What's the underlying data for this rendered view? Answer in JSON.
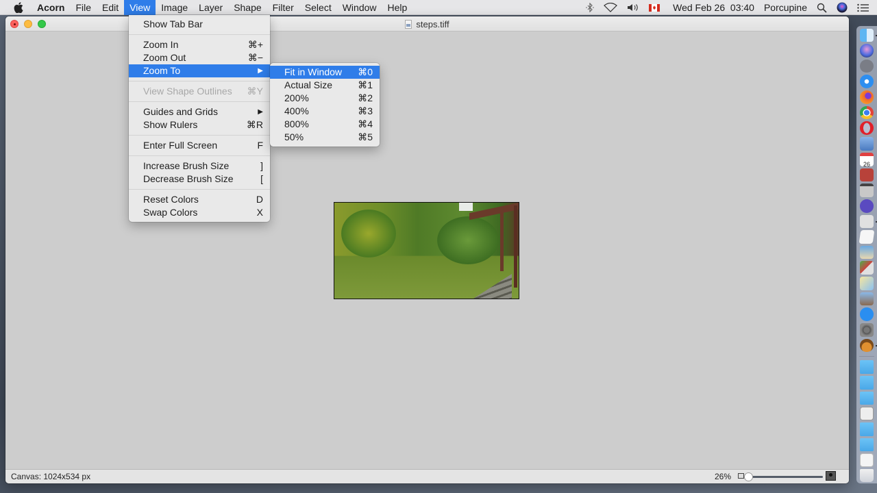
{
  "menubar": {
    "app_name": "Acorn",
    "menus": [
      "File",
      "Edit",
      "View",
      "Image",
      "Layer",
      "Shape",
      "Filter",
      "Select",
      "Window",
      "Help"
    ],
    "active_menu": "View",
    "status": {
      "icons": [
        "bluetooth-icon",
        "wifi-icon",
        "volume-icon",
        "flag-canada-icon"
      ],
      "datetime": "Wed Feb 26  03:40",
      "user": "Porcupine"
    }
  },
  "window": {
    "title": "steps.tiff",
    "status_bar": {
      "canvas_info": "Canvas: 1024x534 px",
      "zoom_percent": "26%",
      "zoom_slider_value": 0.0
    }
  },
  "view_menu": {
    "items": [
      {
        "label": "Show Tab Bar",
        "shortcut": ""
      },
      {
        "label": "Zoom In",
        "shortcut": "⌘+"
      },
      {
        "label": "Zoom Out",
        "shortcut": "⌘−"
      },
      {
        "label": "Zoom To",
        "shortcut": "▶"
      },
      {
        "label": "View Shape Outlines",
        "shortcut": "⌘Y"
      },
      {
        "label": "Guides and Grids",
        "shortcut": "▶"
      },
      {
        "label": "Show Rulers",
        "shortcut": "⌘R"
      },
      {
        "label": "Enter Full Screen",
        "shortcut": "F"
      },
      {
        "label": "Increase Brush Size",
        "shortcut": "]"
      },
      {
        "label": "Decrease Brush Size",
        "shortcut": "["
      },
      {
        "label": "Reset Colors",
        "shortcut": "D"
      },
      {
        "label": "Swap Colors",
        "shortcut": "X"
      }
    ]
  },
  "zoom_to_submenu": {
    "items": [
      {
        "label": "Fit in Window",
        "shortcut": "⌘0"
      },
      {
        "label": "Actual Size",
        "shortcut": "⌘1"
      },
      {
        "label": "200%",
        "shortcut": "⌘2"
      },
      {
        "label": "400%",
        "shortcut": "⌘3"
      },
      {
        "label": "800%",
        "shortcut": "⌘4"
      },
      {
        "label": "50%",
        "shortcut": "⌘5"
      }
    ]
  },
  "dock": {
    "apps": [
      "Finder",
      "Siri",
      "Launchpad",
      "Safari",
      "Firefox",
      "Chrome",
      "Opera",
      "Preview",
      "Calendar",
      "Dictionary",
      "Calculator",
      "BBEdit",
      "Image Capture",
      "TextEdit",
      "Preview Photos",
      "Photo Editor",
      "Maps",
      "Photos",
      "App Store",
      "System Preferences",
      "Acorn"
    ],
    "calendar_day": "26",
    "folders": [
      "Applications",
      "Documents",
      "Downloads",
      "Recent File",
      "Folder",
      "Folder",
      "Screenshot",
      "Trash"
    ]
  },
  "colors": {
    "highlight": "#2f7de9",
    "menubar_bg": "#e6e6e8",
    "canvas_bg": "#cdcdcd"
  }
}
